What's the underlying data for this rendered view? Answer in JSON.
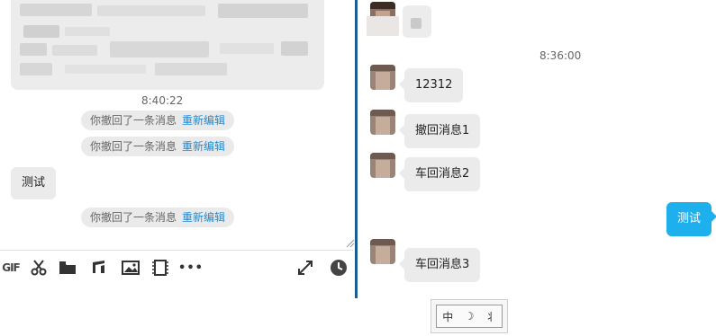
{
  "left_chat": {
    "timestamp": "8:40:22",
    "recall_notices": [
      {
        "text": "你撤回了一条消息",
        "action": "重新编辑"
      },
      {
        "text": "你撤回了一条消息",
        "action": "重新编辑"
      },
      {
        "text": "你撤回了一条消息",
        "action": "重新编辑"
      }
    ],
    "incoming_message": "测试"
  },
  "toolbar": {
    "gif_label": "GIF",
    "more_label": "•••",
    "icons": [
      "gif-icon",
      "scissors-icon",
      "folder-icon",
      "music-icon",
      "image-icon",
      "video-icon",
      "more-icon",
      "expand-icon",
      "clock-icon"
    ]
  },
  "right_chat": {
    "timestamp": "8:36:00",
    "messages": [
      {
        "text": "12312"
      },
      {
        "text": "撤回消息1"
      },
      {
        "text": "车回消息2"
      },
      {
        "text": "车回消息3"
      }
    ],
    "self_message": "测试"
  },
  "ime": {
    "mode": "中",
    "moon": "☽",
    "punct": "⺦"
  },
  "colors": {
    "divider": "#1a5e93",
    "link": "#1f8bd6",
    "self_bubble": "#1db0ec",
    "bubble": "#ebebeb"
  }
}
